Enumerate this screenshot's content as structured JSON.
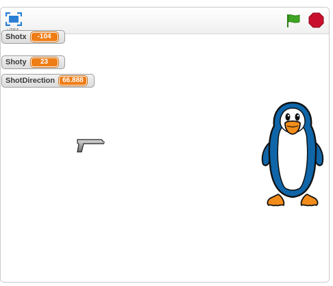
{
  "player": {
    "version": "v384",
    "icons": {
      "fullscreen": "fullscreen-icon",
      "green_flag": "green-flag-icon",
      "stop": "stop-sign-icon"
    },
    "colors": {
      "flag_green": "#3ea523",
      "stop_red": "#c8102e",
      "fullscreen_blue": "#2a7fd4",
      "watcher_value": "#ee7d16"
    }
  },
  "watchers": [
    {
      "label": "Shotx",
      "value": "-104"
    },
    {
      "label": "Shoty",
      "value": "23"
    },
    {
      "label": "ShotDirection",
      "value": "66.888"
    }
  ],
  "sprites": {
    "gun": "gun-sprite",
    "penguin": "penguin-sprite"
  }
}
